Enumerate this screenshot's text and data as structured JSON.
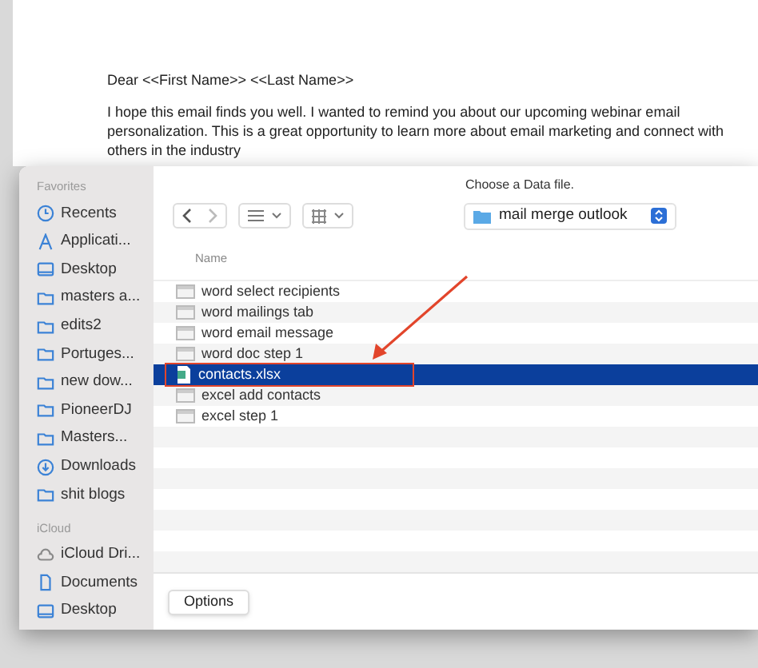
{
  "document": {
    "greeting": "Dear <<First Name>> <<Last Name>>",
    "paragraph": "I hope this email finds you well. I wanted to remind you about our upcoming webinar email personalization. This is a great opportunity to learn more about email marketing and connect with others in the industry"
  },
  "dialog": {
    "title": "Choose a Data file.",
    "location": "mail merge outlook",
    "column": "Name",
    "options_button": "Options"
  },
  "sidebar": [
    {
      "heading": "Favorites",
      "items": [
        {
          "label": "Recents",
          "kind": "clock"
        },
        {
          "label": "Applicati...",
          "kind": "apps"
        },
        {
          "label": "Desktop",
          "kind": "desktop"
        },
        {
          "label": "masters a...",
          "kind": "folder"
        },
        {
          "label": "edits2",
          "kind": "folder"
        },
        {
          "label": "Portuges...",
          "kind": "folder"
        },
        {
          "label": "new dow...",
          "kind": "folder"
        },
        {
          "label": "PioneerDJ",
          "kind": "folder"
        },
        {
          "label": "Masters...",
          "kind": "folder"
        },
        {
          "label": "Downloads",
          "kind": "download"
        },
        {
          "label": "shit blogs",
          "kind": "folder"
        }
      ]
    },
    {
      "heading": "iCloud",
      "items": [
        {
          "label": "iCloud Dri...",
          "kind": "cloud"
        },
        {
          "label": "Documents",
          "kind": "document"
        },
        {
          "label": "Desktop",
          "kind": "desktop"
        }
      ]
    }
  ],
  "files": [
    {
      "name": "word select recipients",
      "kind": "image",
      "selected": false
    },
    {
      "name": "word mailings tab",
      "kind": "image",
      "selected": false
    },
    {
      "name": "word email message",
      "kind": "image",
      "selected": false
    },
    {
      "name": "word doc step 1",
      "kind": "image",
      "selected": false
    },
    {
      "name": "contacts.xlsx",
      "kind": "spreadsheet",
      "selected": true
    },
    {
      "name": "excel add contacts",
      "kind": "image",
      "selected": false
    },
    {
      "name": "excel step 1",
      "kind": "image",
      "selected": false
    }
  ]
}
